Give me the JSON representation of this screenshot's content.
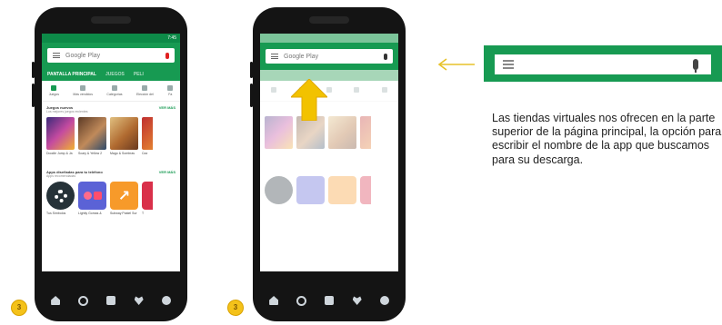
{
  "phone1": {
    "status_time": "7:45",
    "search_placeholder": "Google Play",
    "tabs": [
      "PANTALLA PRINCIPAL",
      "JUEGOS",
      "PELI"
    ],
    "categories": [
      "Juegos",
      "Más vendidos",
      "Categorías",
      "Elección del",
      "Fa"
    ],
    "section1": {
      "title": "Juegos nuevos",
      "subtitle": "Los mejores juegos recientes",
      "more": "VER MÁS",
      "items": [
        "Doodle Jump & Ja",
        "Scary & Yellow 2",
        "Mago & Sombras",
        "Caz"
      ]
    },
    "section2": {
      "title": "Apps diseñadas para tu teléfono",
      "subtitle": "Apps recomendadas",
      "more": "VER MÁS",
      "items": [
        "Tus Símbolos",
        "Lightly Gomas &",
        "Subway Pastel Sur",
        "T"
      ]
    },
    "badge": "3"
  },
  "phone2": {
    "search_placeholder": "Google Play",
    "badge": "3"
  },
  "zoom": {
    "menu_icon": "hamburger-menu-icon",
    "mic_icon": "microphone-icon"
  },
  "caption": "Las tiendas virtuales nos ofrecen en la parte superior de la página principal, la opción para escribir el nombre de la app que buscamos para su descarga.",
  "colors": {
    "play_green": "#179a52",
    "arrow_yellow": "#f2c200",
    "badge_yellow": "#f4c21a"
  }
}
